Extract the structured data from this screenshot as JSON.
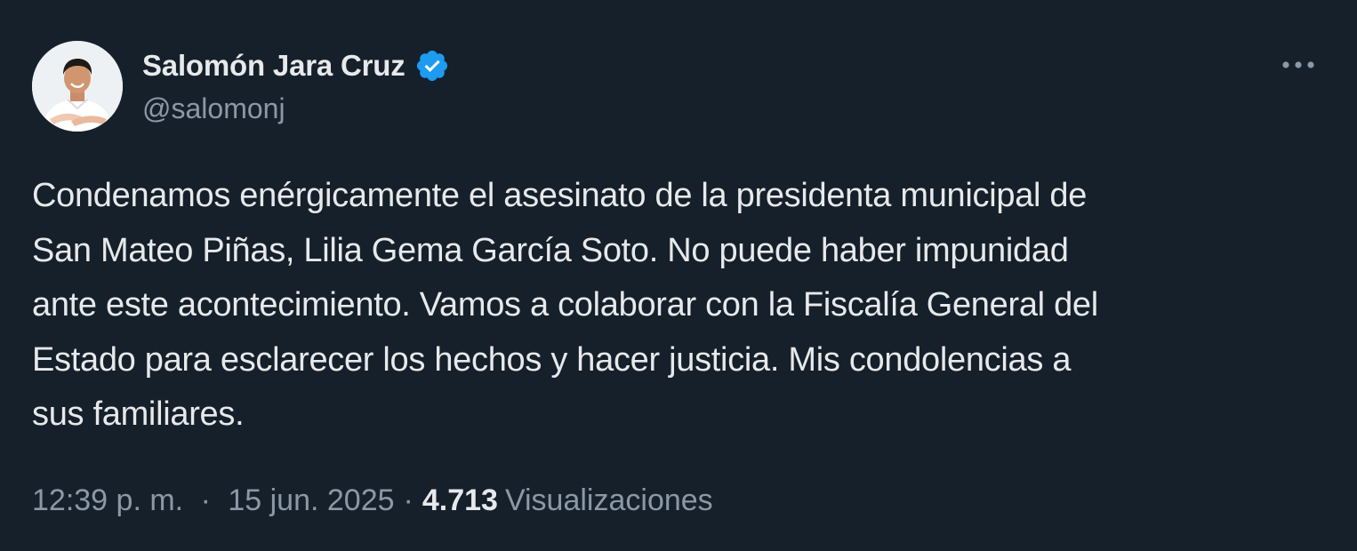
{
  "author": {
    "display_name": "Salomón Jara Cruz",
    "handle": "@salomonj",
    "verified": true,
    "avatar_icon": "profile-photo"
  },
  "tweet": {
    "text": "Condenamos enérgicamente el asesinato de la presidenta municipal de\nSan Mateo Piñas, Lilia Gema García Soto. No puede haber impunidad\nante este acontecimiento. Vamos a colaborar con la Fiscalía General del\nEstado para esclarecer los hechos y hacer justicia. Mis condolencias a\nsus familiares.",
    "time": "12:39 p. m.",
    "date": "15 jun. 2025",
    "separator": "·",
    "views_count": "4.713",
    "views_label": "Visualizaciones"
  },
  "icons": {
    "more": "more-horizontal-icon",
    "verified": "verified-badge-icon"
  },
  "colors": {
    "background": "#15202b",
    "primary_text": "#e7e9ea",
    "secondary_text": "#8b98a5",
    "verified_blue": "#1d9bf0"
  }
}
